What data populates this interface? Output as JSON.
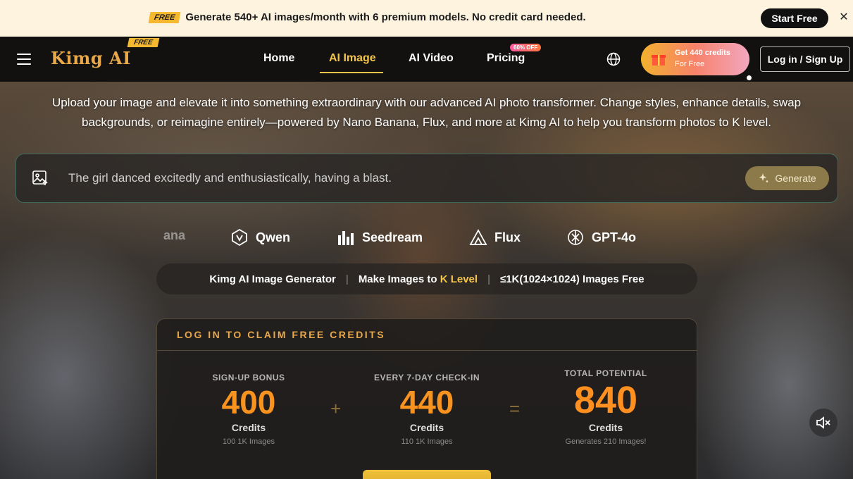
{
  "promo": {
    "tag": "FREE",
    "text": "Generate 540+ AI images/month with 6 premium models. No credit card needed.",
    "cta": "Start Free",
    "close_icon": "close-icon"
  },
  "nav": {
    "logo": "Kimg AI",
    "logo_badge": "FREE",
    "items": [
      {
        "label": "Home"
      },
      {
        "label": "AI Image"
      },
      {
        "label": "AI Video"
      },
      {
        "label": "Pricing"
      }
    ],
    "pricing_badge": "60% OFF",
    "credits_line1": "Get 440 credits",
    "credits_line2": "For Free",
    "login": "Log in / Sign Up"
  },
  "hero": {
    "intro": "Upload your image and elevate it into something extraordinary with our advanced AI photo transformer. Change styles, enhance details, swap backgrounds, or reimagine entirely—powered by Nano Banana, Flux, and more at Kimg AI to help you transform photos to K level.",
    "prompt": "The girl danced excitedly and enthusiastically, having a blast.",
    "generate": "Generate"
  },
  "models": [
    {
      "label": "ana"
    },
    {
      "label": "Qwen"
    },
    {
      "label": "Seedream"
    },
    {
      "label": "Flux"
    },
    {
      "label": "GPT-4o"
    }
  ],
  "info": {
    "part1": "Kimg AI Image Generator",
    "part2a": "Make Images to",
    "part2b": "K Level",
    "part3": "≤1K(1024×1024) Images Free"
  },
  "claim": {
    "title": "LOG IN TO CLAIM FREE CREDITS",
    "stats": [
      {
        "label": "SIGN-UP BONUS",
        "value": "400",
        "unit": "Credits",
        "sub": "100 1K Images"
      },
      {
        "label": "EVERY 7-DAY CHECK-IN",
        "value": "440",
        "unit": "Credits",
        "sub": "110 1K Images"
      },
      {
        "label": "TOTAL POTENTIAL",
        "value": "840",
        "unit": "Credits",
        "sub": "Generates 210 Images!"
      }
    ],
    "plus": "+",
    "equals": "="
  },
  "colors": {
    "accent_gold": "#f5c54a",
    "accent_orange": "#f7931e",
    "promo_bg": "#fdf3df"
  }
}
